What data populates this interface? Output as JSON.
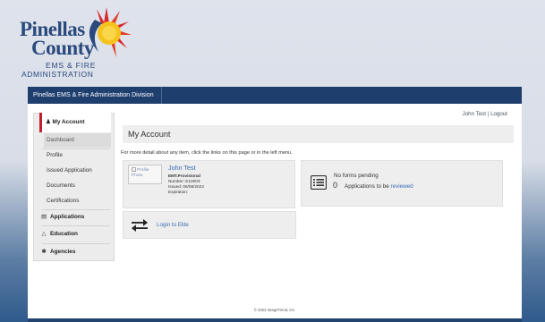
{
  "logo": {
    "line1": "Pinellas",
    "line2": "County",
    "line3": "EMS & FIRE",
    "line4": "ADMINISTRATION"
  },
  "topbar": {
    "title": "Pinellas EMS & Fire Administration Division"
  },
  "user": {
    "name": "John Test",
    "separator": "|",
    "logout": "Logout"
  },
  "sidebar": {
    "header": "My Account",
    "items": [
      {
        "label": "Dashboard"
      },
      {
        "label": "Profile"
      },
      {
        "label": "Issued Application"
      },
      {
        "label": "Documents"
      },
      {
        "label": "Certifications"
      }
    ],
    "sections": [
      {
        "label": "Applications",
        "icon": "file-icon"
      },
      {
        "label": "Education",
        "icon": "graduation-cap-icon"
      },
      {
        "label": "Agencies",
        "icon": "gear-icon"
      }
    ]
  },
  "content": {
    "title": "My Account",
    "intro": "For more detail about any item, click the links on this page or in the left menu."
  },
  "profile_card": {
    "photo_alt": "Profile Photo",
    "name": "John Test",
    "cert": "EMT.Provisional",
    "number": "Number:  E10003",
    "issued": "Issued:  06/08/2023",
    "expiration": "Expiration:"
  },
  "forms_card": {
    "status": "No forms pending",
    "count": "0",
    "label_prefix": "Applications to be",
    "link": "reviewed"
  },
  "elite_card": {
    "label": "Login to Elite"
  },
  "footer": {
    "copyright": "© 2023 ImageTrend, Inc."
  },
  "colors": {
    "nav_bar": "#1e3f6e",
    "accent_red": "#c0202a",
    "link_blue": "#3a6db3"
  }
}
